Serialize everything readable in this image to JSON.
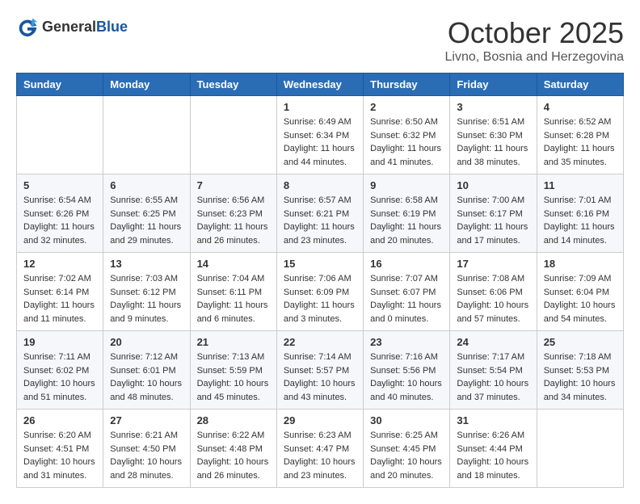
{
  "logo": {
    "general": "General",
    "blue": "Blue"
  },
  "title": "October 2025",
  "location": "Livno, Bosnia and Herzegovina",
  "weekdays": [
    "Sunday",
    "Monday",
    "Tuesday",
    "Wednesday",
    "Thursday",
    "Friday",
    "Saturday"
  ],
  "weeks": [
    [
      {
        "day": "",
        "info": ""
      },
      {
        "day": "",
        "info": ""
      },
      {
        "day": "",
        "info": ""
      },
      {
        "day": "1",
        "info": "Sunrise: 6:49 AM\nSunset: 6:34 PM\nDaylight: 11 hours\nand 44 minutes."
      },
      {
        "day": "2",
        "info": "Sunrise: 6:50 AM\nSunset: 6:32 PM\nDaylight: 11 hours\nand 41 minutes."
      },
      {
        "day": "3",
        "info": "Sunrise: 6:51 AM\nSunset: 6:30 PM\nDaylight: 11 hours\nand 38 minutes."
      },
      {
        "day": "4",
        "info": "Sunrise: 6:52 AM\nSunset: 6:28 PM\nDaylight: 11 hours\nand 35 minutes."
      }
    ],
    [
      {
        "day": "5",
        "info": "Sunrise: 6:54 AM\nSunset: 6:26 PM\nDaylight: 11 hours\nand 32 minutes."
      },
      {
        "day": "6",
        "info": "Sunrise: 6:55 AM\nSunset: 6:25 PM\nDaylight: 11 hours\nand 29 minutes."
      },
      {
        "day": "7",
        "info": "Sunrise: 6:56 AM\nSunset: 6:23 PM\nDaylight: 11 hours\nand 26 minutes."
      },
      {
        "day": "8",
        "info": "Sunrise: 6:57 AM\nSunset: 6:21 PM\nDaylight: 11 hours\nand 23 minutes."
      },
      {
        "day": "9",
        "info": "Sunrise: 6:58 AM\nSunset: 6:19 PM\nDaylight: 11 hours\nand 20 minutes."
      },
      {
        "day": "10",
        "info": "Sunrise: 7:00 AM\nSunset: 6:17 PM\nDaylight: 11 hours\nand 17 minutes."
      },
      {
        "day": "11",
        "info": "Sunrise: 7:01 AM\nSunset: 6:16 PM\nDaylight: 11 hours\nand 14 minutes."
      }
    ],
    [
      {
        "day": "12",
        "info": "Sunrise: 7:02 AM\nSunset: 6:14 PM\nDaylight: 11 hours\nand 11 minutes."
      },
      {
        "day": "13",
        "info": "Sunrise: 7:03 AM\nSunset: 6:12 PM\nDaylight: 11 hours\nand 9 minutes."
      },
      {
        "day": "14",
        "info": "Sunrise: 7:04 AM\nSunset: 6:11 PM\nDaylight: 11 hours\nand 6 minutes."
      },
      {
        "day": "15",
        "info": "Sunrise: 7:06 AM\nSunset: 6:09 PM\nDaylight: 11 hours\nand 3 minutes."
      },
      {
        "day": "16",
        "info": "Sunrise: 7:07 AM\nSunset: 6:07 PM\nDaylight: 11 hours\nand 0 minutes."
      },
      {
        "day": "17",
        "info": "Sunrise: 7:08 AM\nSunset: 6:06 PM\nDaylight: 10 hours\nand 57 minutes."
      },
      {
        "day": "18",
        "info": "Sunrise: 7:09 AM\nSunset: 6:04 PM\nDaylight: 10 hours\nand 54 minutes."
      }
    ],
    [
      {
        "day": "19",
        "info": "Sunrise: 7:11 AM\nSunset: 6:02 PM\nDaylight: 10 hours\nand 51 minutes."
      },
      {
        "day": "20",
        "info": "Sunrise: 7:12 AM\nSunset: 6:01 PM\nDaylight: 10 hours\nand 48 minutes."
      },
      {
        "day": "21",
        "info": "Sunrise: 7:13 AM\nSunset: 5:59 PM\nDaylight: 10 hours\nand 45 minutes."
      },
      {
        "day": "22",
        "info": "Sunrise: 7:14 AM\nSunset: 5:57 PM\nDaylight: 10 hours\nand 43 minutes."
      },
      {
        "day": "23",
        "info": "Sunrise: 7:16 AM\nSunset: 5:56 PM\nDaylight: 10 hours\nand 40 minutes."
      },
      {
        "day": "24",
        "info": "Sunrise: 7:17 AM\nSunset: 5:54 PM\nDaylight: 10 hours\nand 37 minutes."
      },
      {
        "day": "25",
        "info": "Sunrise: 7:18 AM\nSunset: 5:53 PM\nDaylight: 10 hours\nand 34 minutes."
      }
    ],
    [
      {
        "day": "26",
        "info": "Sunrise: 6:20 AM\nSunset: 4:51 PM\nDaylight: 10 hours\nand 31 minutes."
      },
      {
        "day": "27",
        "info": "Sunrise: 6:21 AM\nSunset: 4:50 PM\nDaylight: 10 hours\nand 28 minutes."
      },
      {
        "day": "28",
        "info": "Sunrise: 6:22 AM\nSunset: 4:48 PM\nDaylight: 10 hours\nand 26 minutes."
      },
      {
        "day": "29",
        "info": "Sunrise: 6:23 AM\nSunset: 4:47 PM\nDaylight: 10 hours\nand 23 minutes."
      },
      {
        "day": "30",
        "info": "Sunrise: 6:25 AM\nSunset: 4:45 PM\nDaylight: 10 hours\nand 20 minutes."
      },
      {
        "day": "31",
        "info": "Sunrise: 6:26 AM\nSunset: 4:44 PM\nDaylight: 10 hours\nand 18 minutes."
      },
      {
        "day": "",
        "info": ""
      }
    ]
  ]
}
